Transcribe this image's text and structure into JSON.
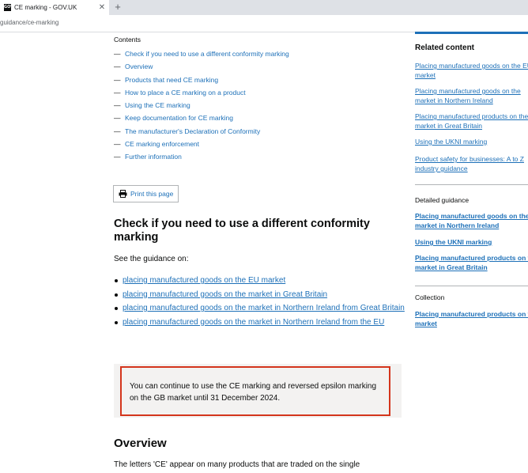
{
  "browser": {
    "tab_title": "CE marking - GOV.UK",
    "tab_favicon": "GOV",
    "close_glyph": "✕",
    "new_tab_glyph": "+",
    "url": "guidance/ce-marking"
  },
  "contents": {
    "heading": "Contents",
    "dash": "—",
    "items": [
      "Check if you need to use a different conformity marking",
      "Overview",
      "Products that need CE marking",
      "How to place a CE marking on a product",
      "Using the CE marking",
      "Keep documentation for CE marking",
      "The manufacturer's Declaration of Conformity",
      "CE marking enforcement",
      "Further information"
    ]
  },
  "print_button": {
    "label": "Print this page",
    "icon": "printer-icon"
  },
  "section": {
    "heading": "Check if you need to use a different conformity marking",
    "intro": "See the guidance on:",
    "links": [
      "placing manufactured goods on the EU market",
      "placing manufactured goods on the market in Great Britain",
      "placing manufactured goods on the market in Northern Ireland from Great Britain",
      "placing manufactured goods on the market in Northern Ireland from the EU"
    ],
    "callout": "You can continue to use the CE marking and reversed epsilon marking on the GB market until 31 December 2024."
  },
  "overview": {
    "heading": "Overview",
    "text": "The letters 'CE' appear on many products that are traded on the single"
  },
  "sidebar": {
    "related_title": "Related content",
    "related": [
      "Placing manufactured goods on the EU market",
      "Placing manufactured goods on the market in Northern Ireland",
      "Placing manufactured products on the market in Great Britain",
      "Using the UKNI marking",
      "Product safety for businesses: A to Z industry guidance"
    ],
    "detailed_title": "Detailed guidance",
    "detailed": [
      "Placing manufactured goods on the market in Northern Ireland",
      "Using the UKNI marking",
      "Placing manufactured products on the market in Great Britain"
    ],
    "collection_title": "Collection",
    "collection": [
      "Placing manufactured products on the market"
    ]
  },
  "colors": {
    "link": "#1d70b8",
    "text": "#0b0c0c",
    "callout_border": "#d4351c",
    "callout_bg": "#f3f2f1"
  }
}
